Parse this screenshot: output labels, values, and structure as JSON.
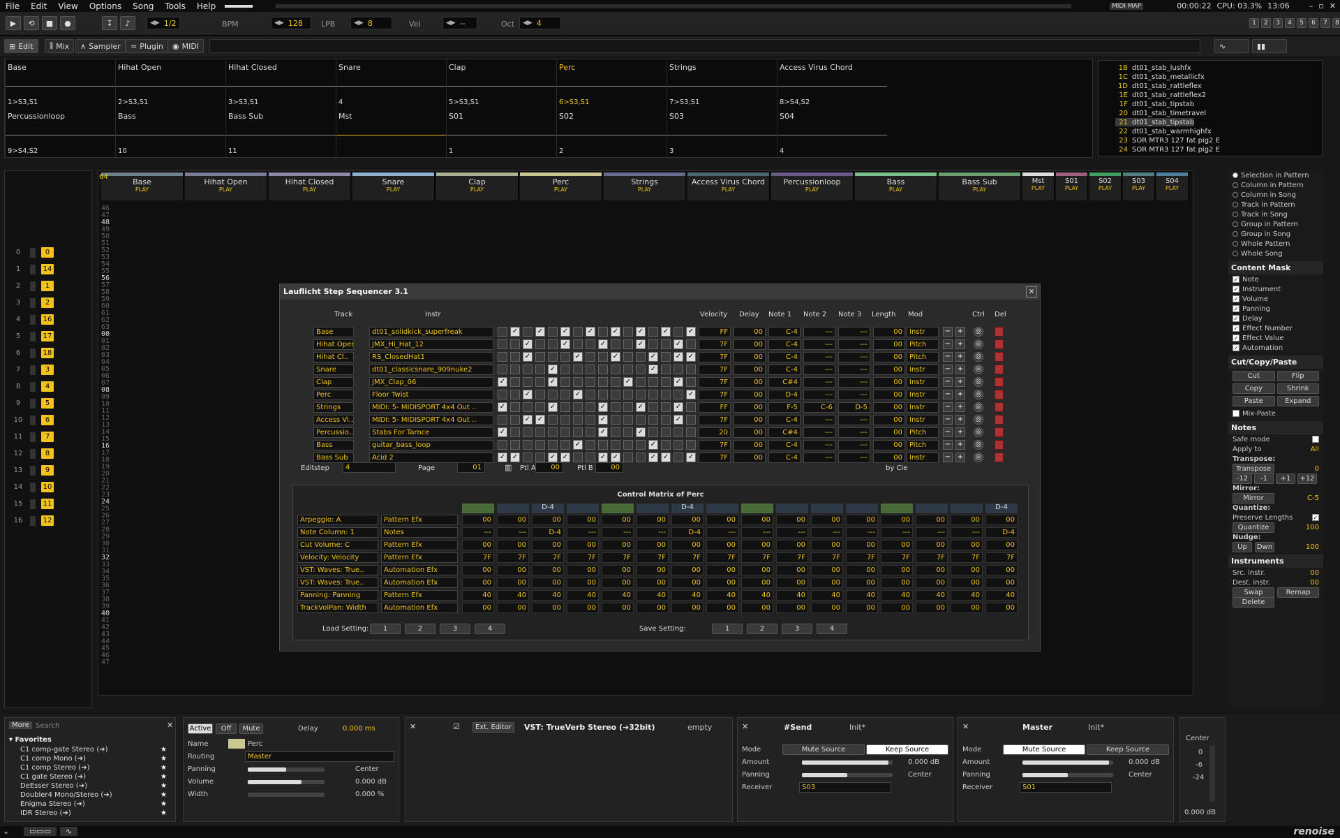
{
  "menu": [
    "File",
    "Edit",
    "View",
    "Options",
    "Song",
    "Tools",
    "Help"
  ],
  "status_right": {
    "midimap": "MIDI MAP",
    "time": "00:00:22",
    "cpu": "CPU: 03.3%",
    "clock": "13:06"
  },
  "transport": {
    "pattern_length": "1/2",
    "bpm_label": "BPM",
    "bpm": "128",
    "lpb_label": "LPB",
    "lpb": "8",
    "vel_label": "Vel",
    "vel": "--",
    "oct_label": "Oct",
    "oct": "4"
  },
  "tabs": [
    "Edit",
    "Mix",
    "Sampler",
    "Plugin",
    "MIDI"
  ],
  "matrix_top": [
    {
      "name": "Base",
      "slot": "1>S3,S1"
    },
    {
      "name": "Hihat Open",
      "slot": "2>S3,S1"
    },
    {
      "name": "Hihat Closed",
      "slot": "3>S3,S1"
    },
    {
      "name": "Snare",
      "slot": "4"
    },
    {
      "name": "Clap",
      "slot": "5>S3,S1"
    },
    {
      "name": "Perc",
      "slot": "6>S3,S1"
    },
    {
      "name": "Strings",
      "slot": "7>S3,S1"
    },
    {
      "name": "Access Virus Chord",
      "slot": "8>S4,S2"
    }
  ],
  "matrix_bottom": [
    {
      "name": "Percussionloop",
      "slot": "9>S4,S2"
    },
    {
      "name": "Bass",
      "slot": "10"
    },
    {
      "name": "Bass Sub",
      "slot": "11"
    },
    {
      "name": "Mst",
      "slot": ""
    },
    {
      "name": "S01",
      "slot": "1"
    },
    {
      "name": "S02",
      "slot": "2"
    },
    {
      "name": "S03",
      "slot": "3"
    },
    {
      "name": "S04",
      "slot": "4"
    }
  ],
  "instruments": [
    {
      "n": "1B",
      "t": "dt01_stab_lushfx"
    },
    {
      "n": "1C",
      "t": "dt01_stab_metallicfx"
    },
    {
      "n": "1D",
      "t": "dt01_stab_rattleflex"
    },
    {
      "n": "1E",
      "t": "dt01_stab_rattleflex2"
    },
    {
      "n": "1F",
      "t": "dt01_stab_tipstab"
    },
    {
      "n": "20",
      "t": "dt01_stab_timetravel"
    },
    {
      "n": "21",
      "t": "dt01_stab_tipstab"
    },
    {
      "n": "22",
      "t": "dt01_stab_warmhighfx"
    },
    {
      "n": "23",
      "t": "SOR MTR3 127 fat pig2 E"
    },
    {
      "n": "24",
      "t": "SOR MTR3 127 fat pig2 E"
    }
  ],
  "tracks": [
    {
      "name": "Base",
      "color": "#6e7f8f"
    },
    {
      "name": "Hihat Open",
      "color": "#7a7a9a"
    },
    {
      "name": "Hihat Closed",
      "color": "#8a8aa8"
    },
    {
      "name": "Snare",
      "color": "#8fb0d0"
    },
    {
      "name": "Clap",
      "color": "#a8b090"
    },
    {
      "name": "Perc",
      "color": "#c8c890"
    },
    {
      "name": "Strings",
      "color": "#6a6a90"
    },
    {
      "name": "Access Virus Chord",
      "color": "#4a6a70"
    },
    {
      "name": "Percussionloop",
      "color": "#6a5a8a"
    },
    {
      "name": "Bass",
      "color": "#7ac08a"
    },
    {
      "name": "Bass Sub",
      "color": "#6aa070"
    },
    {
      "name": "Mst",
      "color": "#dddddd"
    },
    {
      "name": "S01",
      "color": "#a06080"
    },
    {
      "name": "S02",
      "color": "#40a060"
    },
    {
      "name": "S03",
      "color": "#508080"
    },
    {
      "name": "S04",
      "color": "#5080a0"
    }
  ],
  "play_label": "PLAY",
  "pattern_index": "64",
  "seq": [
    {
      "i": "0",
      "v": "0"
    },
    {
      "i": "1",
      "v": "14"
    },
    {
      "i": "2",
      "v": "1"
    },
    {
      "i": "3",
      "v": "2"
    },
    {
      "i": "4",
      "v": "16"
    },
    {
      "i": "5",
      "v": "17"
    },
    {
      "i": "6",
      "v": "18"
    },
    {
      "i": "7",
      "v": "3"
    },
    {
      "i": "8",
      "v": "4"
    },
    {
      "i": "9",
      "v": "5"
    },
    {
      "i": "10",
      "v": "6"
    },
    {
      "i": "11",
      "v": "7"
    },
    {
      "i": "12",
      "v": "8"
    },
    {
      "i": "13",
      "v": "9"
    },
    {
      "i": "14",
      "v": "10"
    },
    {
      "i": "15",
      "v": "11"
    },
    {
      "i": "16",
      "v": "12"
    }
  ],
  "dialog": {
    "title": "Lauflicht Step Sequencer 3.1",
    "headers": {
      "track": "Track",
      "instr": "Instr",
      "velocity": "Velocity",
      "delay": "Delay",
      "note1": "Note 1",
      "note2": "Note 2",
      "note3": "Note 3",
      "length": "Length",
      "mod": "Mod",
      "ctrl": "Ctrl",
      "del": "Del"
    },
    "rows": [
      {
        "track": "Base",
        "instr": "dt01_solidkick_superfreak",
        "vel": "FF",
        "delay": "00",
        "n1": "C-4",
        "n2": "---",
        "n3": "---",
        "len": "00",
        "mod": "Instr",
        "steps": [
          0,
          1,
          0,
          1,
          0,
          1,
          0,
          1,
          0,
          1,
          0,
          1,
          0,
          1,
          0,
          1
        ]
      },
      {
        "track": "Hihat Open",
        "instr": "JMX_Hi_Hat_12",
        "vel": "7F",
        "delay": "00",
        "n1": "C-4",
        "n2": "---",
        "n3": "---",
        "len": "00",
        "mod": "Pitch",
        "steps": [
          0,
          0,
          1,
          0,
          0,
          1,
          0,
          0,
          1,
          0,
          0,
          1,
          0,
          0,
          1,
          0
        ]
      },
      {
        "track": "Hihat Cl..",
        "instr": "RS_ClosedHat1",
        "vel": "7F",
        "delay": "00",
        "n1": "C-4",
        "n2": "---",
        "n3": "---",
        "len": "00",
        "mod": "Pitch",
        "steps": [
          0,
          0,
          1,
          0,
          0,
          0,
          1,
          0,
          0,
          1,
          0,
          0,
          1,
          0,
          1,
          1
        ]
      },
      {
        "track": "Snare",
        "instr": "dt01_classicsnare_909nuke2",
        "vel": "7F",
        "delay": "00",
        "n1": "C-4",
        "n2": "---",
        "n3": "---",
        "len": "00",
        "mod": "Instr",
        "steps": [
          0,
          0,
          0,
          0,
          1,
          0,
          0,
          0,
          0,
          0,
          0,
          0,
          1,
          0,
          0,
          0
        ]
      },
      {
        "track": "Clap",
        "instr": "JMX_Clap_06",
        "vel": "7F",
        "delay": "00",
        "n1": "C#4",
        "n2": "---",
        "n3": "---",
        "len": "00",
        "mod": "Instr",
        "steps": [
          1,
          0,
          0,
          0,
          1,
          0,
          0,
          0,
          0,
          0,
          1,
          0,
          0,
          0,
          1,
          0
        ]
      },
      {
        "track": "Perc",
        "instr": "Floor Twist",
        "vel": "7F",
        "delay": "00",
        "n1": "D-4",
        "n2": "---",
        "n3": "---",
        "len": "00",
        "mod": "Instr",
        "steps": [
          0,
          0,
          1,
          0,
          0,
          0,
          1,
          0,
          0,
          0,
          0,
          0,
          0,
          0,
          0,
          1
        ]
      },
      {
        "track": "Strings",
        "instr": "MIDI: 5- MIDISPORT 4x4 Out ..",
        "vel": "FF",
        "delay": "00",
        "n1": "F-5",
        "n2": "C-6",
        "n3": "D-5",
        "len": "00",
        "mod": "Instr",
        "steps": [
          1,
          0,
          0,
          0,
          1,
          0,
          0,
          0,
          1,
          0,
          0,
          1,
          0,
          0,
          1,
          0
        ]
      },
      {
        "track": "Access Vi..",
        "instr": "MIDI: 5- MIDISPORT 4x4 Out ..",
        "vel": "7F",
        "delay": "00",
        "n1": "C-4",
        "n2": "---",
        "n3": "---",
        "len": "00",
        "mod": "Instr",
        "steps": [
          0,
          0,
          1,
          1,
          0,
          0,
          0,
          0,
          1,
          0,
          0,
          0,
          0,
          0,
          1,
          0
        ]
      },
      {
        "track": "Percussio..",
        "instr": "Stabs For Tarnce",
        "vel": "20",
        "delay": "00",
        "n1": "C#4",
        "n2": "---",
        "n3": "---",
        "len": "00",
        "mod": "Pitch",
        "steps": [
          1,
          0,
          0,
          0,
          0,
          0,
          0,
          0,
          1,
          0,
          0,
          1,
          0,
          0,
          0,
          0
        ]
      },
      {
        "track": "Bass",
        "instr": "guitar_bass_loop",
        "vel": "7F",
        "delay": "00",
        "n1": "C-4",
        "n2": "---",
        "n3": "---",
        "len": "00",
        "mod": "Pitch",
        "steps": [
          0,
          0,
          0,
          0,
          0,
          0,
          1,
          0,
          0,
          0,
          0,
          0,
          1,
          0,
          0,
          0
        ]
      },
      {
        "track": "Bass Sub",
        "instr": "Acid 2",
        "vel": "7F",
        "delay": "00",
        "n1": "C-4",
        "n2": "---",
        "n3": "---",
        "len": "00",
        "mod": "Instr",
        "steps": [
          1,
          1,
          0,
          0,
          1,
          1,
          0,
          0,
          1,
          1,
          0,
          0,
          1,
          1,
          0,
          1
        ]
      }
    ],
    "editstep_label": "Editstep",
    "editstep": "4",
    "page_label": "Page",
    "page": "01",
    "ptla_label": "Ptl A",
    "ptla": "00",
    "ptlb_label": "Ptl B",
    "ptlb": "00",
    "by": "by Cie",
    "cm_title": "Control Matrix of Perc",
    "cm_header": [
      "",
      "",
      "D-4",
      "",
      "",
      "",
      "D-4",
      "",
      "",
      "",
      "",
      "",
      "",
      "",
      "",
      "D-4"
    ],
    "cm_rows": [
      {
        "label": "Arpeggio: A",
        "type": "Pattern Efx",
        "vals": [
          "00",
          "00",
          "00",
          "00",
          "00",
          "00",
          "00",
          "00",
          "00",
          "00",
          "00",
          "00",
          "00",
          "00",
          "00",
          "00"
        ]
      },
      {
        "label": "Note Column: 1",
        "type": "Notes",
        "vals": [
          "---",
          "---",
          "D-4",
          "---",
          "---",
          "---",
          "D-4",
          "---",
          "---",
          "---",
          "---",
          "---",
          "---",
          "---",
          "---",
          "D-4"
        ]
      },
      {
        "label": "Cut Volume: C",
        "type": "Pattern Efx",
        "vals": [
          "00",
          "00",
          "00",
          "00",
          "00",
          "00",
          "00",
          "00",
          "00",
          "00",
          "00",
          "00",
          "00",
          "00",
          "00",
          "00"
        ]
      },
      {
        "label": "Velocity: Velocity",
        "type": "Pattern Efx",
        "vals": [
          "7F",
          "7F",
          "7F",
          "7F",
          "7F",
          "7F",
          "7F",
          "7F",
          "7F",
          "7F",
          "7F",
          "7F",
          "7F",
          "7F",
          "7F",
          "7F"
        ]
      },
      {
        "label": "VST: Waves: True..",
        "type": "Automation Efx",
        "vals": [
          "00",
          "00",
          "00",
          "00",
          "00",
          "00",
          "00",
          "00",
          "00",
          "00",
          "00",
          "00",
          "00",
          "00",
          "00",
          "00"
        ]
      },
      {
        "label": "VST: Waves: True..",
        "type": "Automation Efx",
        "vals": [
          "00",
          "00",
          "00",
          "00",
          "00",
          "00",
          "00",
          "00",
          "00",
          "00",
          "00",
          "00",
          "00",
          "00",
          "00",
          "00"
        ]
      },
      {
        "label": "Panning: Panning",
        "type": "Pattern Efx",
        "vals": [
          "40",
          "40",
          "40",
          "40",
          "40",
          "40",
          "40",
          "40",
          "40",
          "40",
          "40",
          "40",
          "40",
          "40",
          "40",
          "40"
        ]
      },
      {
        "label": "TrackVolPan: Width",
        "type": "Automation Efx",
        "vals": [
          "00",
          "00",
          "00",
          "00",
          "00",
          "00",
          "00",
          "00",
          "00",
          "00",
          "00",
          "00",
          "00",
          "00",
          "00",
          "00"
        ]
      }
    ],
    "load_label": "Load Setting:",
    "save_label": "Save Setting:",
    "slots": [
      "1",
      "2",
      "3",
      "4"
    ]
  },
  "right": {
    "scope": [
      "Selection in Pattern",
      "Column in Pattern",
      "Column in Song",
      "Track in Pattern",
      "Track in Song",
      "Group in Pattern",
      "Group in Song",
      "Whole Pattern",
      "Whole Song"
    ],
    "mask_title": "Content Mask",
    "mask": [
      "Note",
      "Instrument",
      "Volume",
      "Panning",
      "Delay",
      "Effect Number",
      "Effect Value",
      "Automation"
    ],
    "ccp_title": "Cut/Copy/Paste",
    "ccp": [
      "Cut",
      "Flip",
      "Copy",
      "Shrink",
      "Paste",
      "Expand"
    ],
    "mixpaste": "Mix-Paste",
    "notes_title": "Notes",
    "safe": "Safe mode",
    "apply": "Apply to",
    "apply_val": "All",
    "transpose": "Transpose:",
    "transpose_btn": "Transpose",
    "transpose_val": "0",
    "tsteps": [
      "-12",
      "-1",
      "+1",
      "+12"
    ],
    "mirror": "Mirror:",
    "mirror_btn": "Mirror",
    "mirror_val": "C-5",
    "quant": "Quantize:",
    "preserve": "Preserve Lengths",
    "quant_btn": "Quantize",
    "quant_val": "100",
    "nudge": "Nudge:",
    "up": "Up",
    "dwn": "Dwn",
    "nudge_val": "100",
    "instr_title": "Instruments",
    "src": "Src. instr.",
    "src_val": "00",
    "dest": "Dest. instr.",
    "dest_val": "00",
    "swap": "Swap",
    "remap": "Remap",
    "delete": "Delete"
  },
  "bottom": {
    "more": "More",
    "search": "Search",
    "fav_title": "Favorites",
    "favs": [
      "C1 comp-gate Stereo (➔)",
      "C1 comp Mono (➔)",
      "C1 comp Stereo (➔)",
      "C1 gate Stereo (➔)",
      "DeEsser Stereo (➔)",
      "Doubler4 Mono/Stereo (➔)",
      "Enigma Stereo (➔)",
      "IDR Stereo (➔)"
    ],
    "track": {
      "active": "Active",
      "off": "Off",
      "mute": "Mute",
      "delay_label": "Delay",
      "delay": "0.000 ms",
      "name_label": "Name",
      "name": "Perc",
      "routing_label": "Routing",
      "routing": "Master",
      "panning_label": "Panning",
      "panning": "Center",
      "volume_label": "Volume",
      "volume": "0.000 dB",
      "width_label": "Width",
      "width": "0.000 %",
      "panning_level": 0.5,
      "volume_level": 0.7,
      "width_level": 0.0
    },
    "vst": {
      "ext": "Ext. Editor",
      "title": "VST: TrueVerb Stereo (➔32bit)",
      "preset": "empty"
    },
    "send": {
      "title": "#Send",
      "init": "Init*",
      "mode": "Mode",
      "mute_src": "Mute Source",
      "keep_src": "Keep Source",
      "amount": "Amount",
      "amount_val": "0.000 dB",
      "panning": "Panning",
      "pan_val": "Center",
      "receiver": "Receiver",
      "recv_val": "S03",
      "amount_level": 0.95,
      "pan_level": 0.5
    },
    "master": {
      "title": "Master",
      "init": "Init*",
      "mode": "Mode",
      "mute_src": "Mute Source",
      "keep_src": "Keep Source",
      "amount": "Amount",
      "amount_val": "0.000 dB",
      "panning": "Panning",
      "pan_val": "Center",
      "receiver": "Receiver",
      "recv_val": "S01",
      "amount_level": 0.95,
      "pan_level": 0.5
    },
    "meter": {
      "label": "Center",
      "t0": "0",
      "t6": "-6",
      "t24": "-24",
      "val": "0.000 dB"
    }
  },
  "brand": "renoise"
}
